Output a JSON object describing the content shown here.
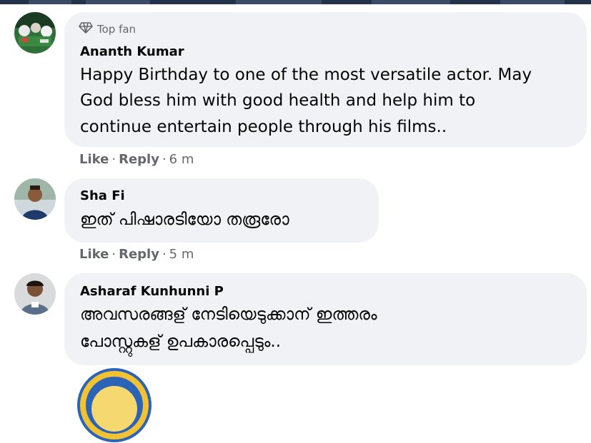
{
  "comments": [
    {
      "badge": "Top fan",
      "author": "Ananth Kumar",
      "lines": [
        "Happy Birthday to one of the most versatile actor. May",
        "God bless him with good health and help him to",
        "continue entertain people through his films.."
      ],
      "like_label": "Like",
      "reply_label": "Reply",
      "time": "6 m"
    },
    {
      "author": "Sha Fi",
      "lines": [
        "ഇത് പിഷാരടിയോ തരൂരോ"
      ],
      "like_label": "Like",
      "reply_label": "Reply",
      "time": "5 m"
    },
    {
      "author": "Asharaf Kunhunni P",
      "lines": [
        "അവസരങ്ങള് നേടിയെടുക്കാന് ഇത്തരം",
        "പോസ്റ്റുകള് ഉപകാരപ്പെടും.."
      ]
    }
  ],
  "colors": {
    "bubble": "#f0f2f5",
    "secondary_text": "#65676b",
    "primary_text": "#050505"
  },
  "icons": {
    "badge": "diamond-icon"
  }
}
